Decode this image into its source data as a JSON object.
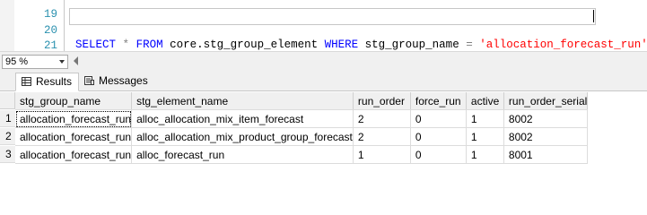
{
  "editor": {
    "lines": [
      {
        "number": "19",
        "text": ""
      },
      {
        "number": "20",
        "kw_select": "SELECT",
        "star": "*",
        "kw_from": "FROM",
        "table": "core.stg_group_element",
        "kw_where": "WHERE",
        "column": "stg_group_name",
        "eq": "=",
        "literal": "'allocation_forecast_run'"
      },
      {
        "number": "21",
        "text": ""
      }
    ]
  },
  "zoom": {
    "value": "95 %"
  },
  "tabs": [
    {
      "label": "Results",
      "icon": "grid-icon",
      "active": true
    },
    {
      "label": "Messages",
      "icon": "messages-icon",
      "active": false
    }
  ],
  "results": {
    "columns": [
      "stg_group_name",
      "stg_element_name",
      "run_order",
      "force_run",
      "active",
      "run_order_serial"
    ],
    "rows": [
      {
        "num": "1",
        "cells": [
          "allocation_forecast_run",
          "alloc_allocation_mix_item_forecast",
          "2",
          "0",
          "1",
          "8002"
        ]
      },
      {
        "num": "2",
        "cells": [
          "allocation_forecast_run",
          "alloc_allocation_mix_product_group_forecast",
          "2",
          "0",
          "1",
          "8002"
        ]
      },
      {
        "num": "3",
        "cells": [
          "allocation_forecast_run",
          "alloc_forecast_run",
          "1",
          "0",
          "1",
          "8001"
        ]
      }
    ]
  },
  "colors": {
    "keyword": "#0000ff",
    "string": "#ff0000",
    "operator": "#808080",
    "line_number": "#2b91af"
  }
}
